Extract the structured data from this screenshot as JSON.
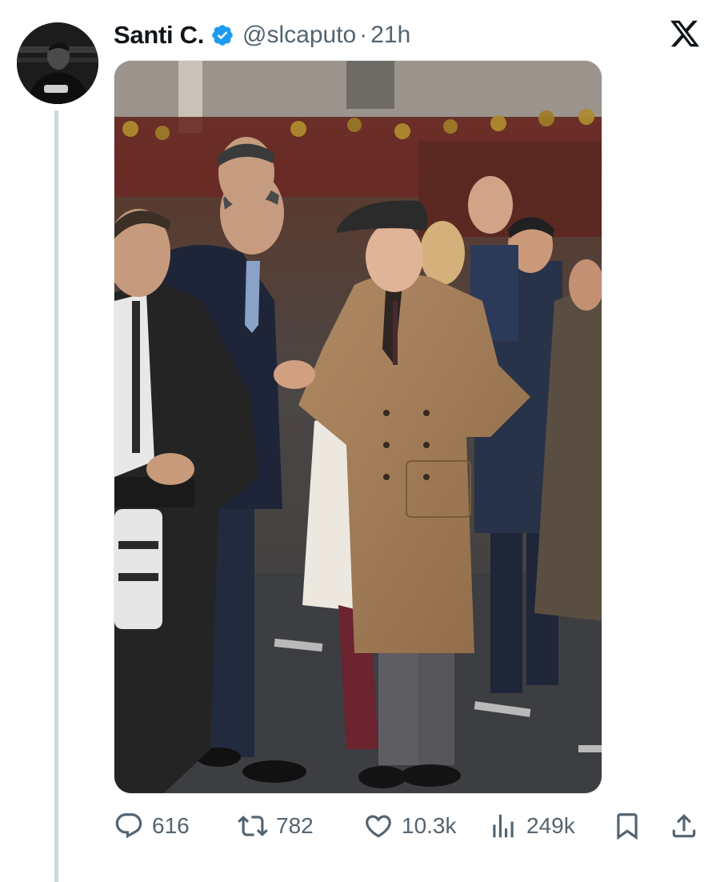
{
  "tweet": {
    "author": {
      "display_name": "Santi C.",
      "handle": "@slcaputo",
      "verified": true
    },
    "separator": "·",
    "timestamp": "21h",
    "media": {
      "type": "photo"
    }
  },
  "actions": {
    "replies": "616",
    "reposts": "782",
    "likes": "10.3k",
    "views": "249k"
  },
  "colors": {
    "verified": "#1d9bf0",
    "muted_text": "#536471",
    "thread_line": "#cfd9de"
  },
  "icons": [
    "reply-icon",
    "repost-icon",
    "like-icon",
    "views-icon",
    "bookmark-icon",
    "share-icon",
    "x-logo-icon",
    "verified-badge-icon"
  ]
}
